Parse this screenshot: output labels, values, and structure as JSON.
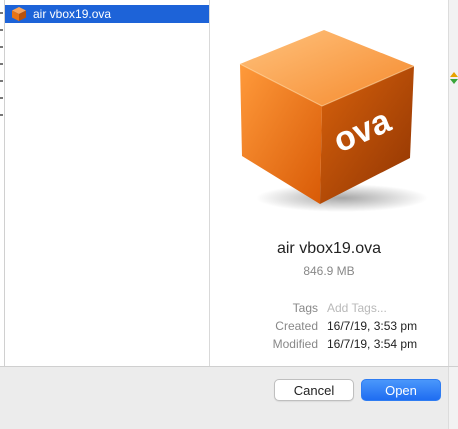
{
  "file_list": {
    "items": [
      {
        "name": "air vbox19.ova",
        "icon": "ova-package-icon",
        "selected": true
      }
    ]
  },
  "preview": {
    "icon": "ova-cube-icon",
    "icon_text": "ova",
    "file_name": "air vbox19.ova",
    "file_size": "846.9 MB",
    "tags_label": "Tags",
    "tags_placeholder": "Add Tags...",
    "created_label": "Created",
    "created_value": "16/7/19, 3:53 pm",
    "modified_label": "Modified",
    "modified_value": "16/7/19, 3:54 pm"
  },
  "buttons": {
    "cancel_label": "Cancel",
    "open_label": "Open"
  },
  "colors": {
    "selection": "#1d63d8",
    "primary_button": "#2f7ff5",
    "ova_orange": "#f07d1f"
  }
}
